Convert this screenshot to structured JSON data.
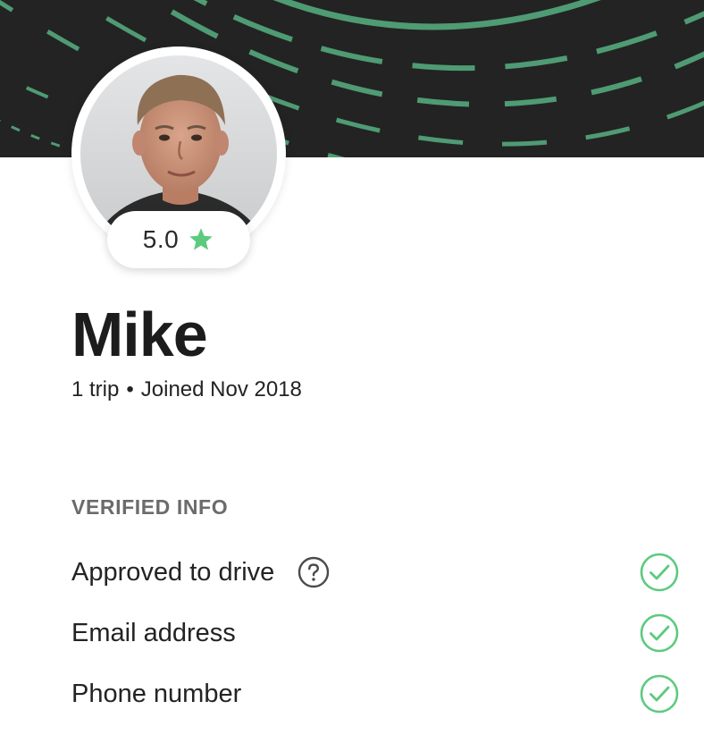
{
  "profile": {
    "rating": "5.0",
    "name": "Mike",
    "trips": "1 trip",
    "separator": "•",
    "joined": "Joined Nov 2018"
  },
  "verified": {
    "title": "VERIFIED INFO",
    "items": [
      {
        "label": "Approved to drive",
        "has_help": true,
        "verified": true
      },
      {
        "label": "Email address",
        "has_help": false,
        "verified": true
      },
      {
        "label": "Phone number",
        "has_help": false,
        "verified": true
      }
    ]
  },
  "icons": {
    "star": "star-icon",
    "help": "question-circle-icon",
    "check": "check-circle-icon"
  },
  "colors": {
    "accent": "#5ccb7e",
    "banner": "#232323",
    "banner_pattern": "#4f9b74",
    "text": "#232323",
    "muted": "#6b6b6b"
  }
}
